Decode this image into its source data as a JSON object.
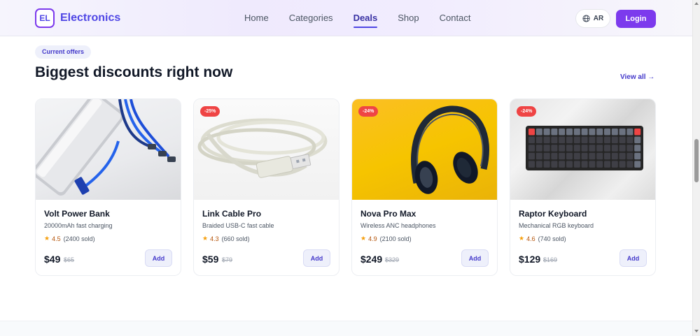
{
  "header": {
    "logo_mark": "EL",
    "brand": "Electronics",
    "nav": [
      {
        "label": "Home",
        "active": false
      },
      {
        "label": "Categories",
        "active": false
      },
      {
        "label": "Deals",
        "active": true
      },
      {
        "label": "Shop",
        "active": false
      },
      {
        "label": "Contact",
        "active": false
      }
    ],
    "lang_label": "AR",
    "lang_icon": "globe-icon",
    "login_label": "Login"
  },
  "section": {
    "pill": "Current offers",
    "title": "Biggest discounts right now",
    "view_all": "View all →"
  },
  "products": [
    {
      "name": "Volt Power Bank",
      "desc": "20000mAh fast charging",
      "rating": "4.5",
      "sold": "(2400 sold)",
      "price": "$49",
      "old_price": "$65",
      "badge": "",
      "add_label": "Add"
    },
    {
      "name": "Link Cable Pro",
      "desc": "Braided USB-C fast cable",
      "rating": "4.3",
      "sold": "(660 sold)",
      "price": "$59",
      "old_price": "$79",
      "badge": "-25%",
      "add_label": "Add"
    },
    {
      "name": "Nova Pro Max",
      "desc": "Wireless ANC headphones",
      "rating": "4.9",
      "sold": "(2100 sold)",
      "price": "$249",
      "old_price": "$329",
      "badge": "-24%",
      "add_label": "Add"
    },
    {
      "name": "Raptor Keyboard",
      "desc": "Mechanical RGB keyboard",
      "rating": "4.6",
      "sold": "(740 sold)",
      "price": "$129",
      "old_price": "$169",
      "badge": "-24%",
      "add_label": "Add"
    }
  ],
  "colors": {
    "brand": "#4f46e5",
    "accent": "#7c3aed",
    "discount": "#ef4444",
    "star": "#f59e0b"
  }
}
